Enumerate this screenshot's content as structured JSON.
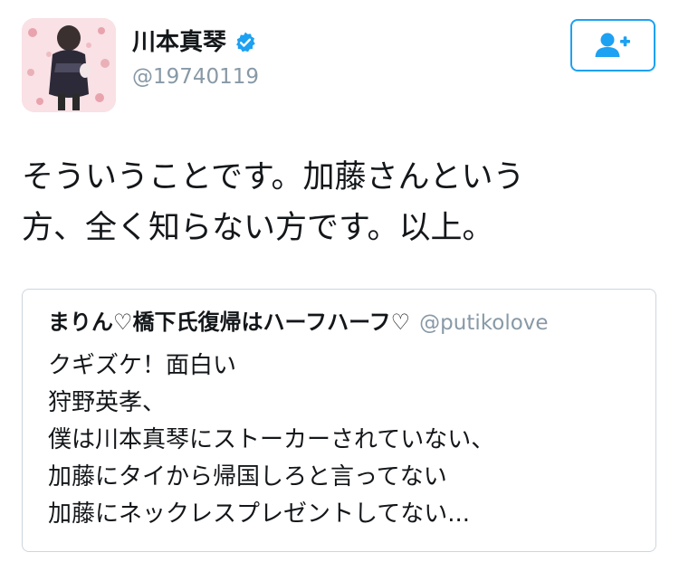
{
  "author": {
    "display_name": "川本真琴",
    "handle": "@19740119",
    "verified": true,
    "avatar_icon": "avatar-photo"
  },
  "follow_button": {
    "icon": "follow-person-plus-icon",
    "accent_color": "#1da1f2"
  },
  "tweet": {
    "lines": [
      "そういうことです。加藤さんという",
      "方、全く知らない方です。以上。"
    ]
  },
  "quoted_tweet": {
    "display_name": "まりん♡橋下氏復帰はハーフハーフ♡",
    "handle": "@putikolove",
    "lines": [
      "クギズケ！面白い",
      "狩野英孝、",
      "僕は川本真琴にストーカーされていない、",
      "加藤にタイから帰国しろと言ってない",
      "加藤にネックレスプレゼントしてない..."
    ]
  },
  "colors": {
    "text": "#14171a",
    "secondary": "#8899a6",
    "border": "#ccd6dd",
    "accent": "#1da1f2"
  }
}
